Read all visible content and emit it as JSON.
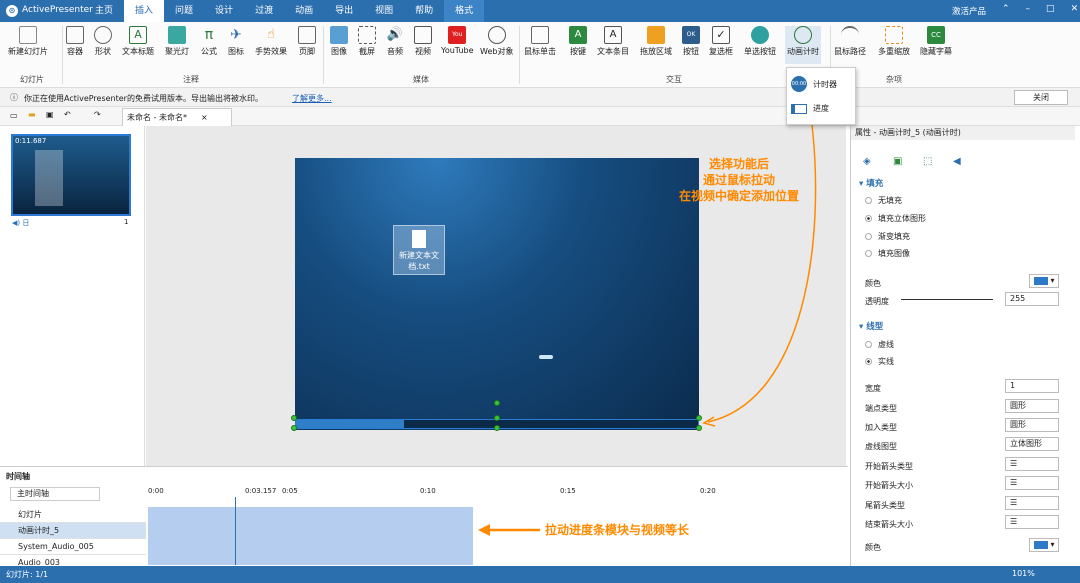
{
  "app": {
    "name": "ActivePresenter",
    "product": "激活产品",
    "controls": [
      "⌃",
      "–",
      "□",
      "✕"
    ]
  },
  "tabs": [
    "主页",
    "插入",
    "问题",
    "设计",
    "过渡",
    "动画",
    "导出",
    "视图",
    "帮助",
    "格式"
  ],
  "ribbon": {
    "items": [
      "新建幻灯片",
      "容器",
      "形状",
      "文本标题",
      "聚光灯",
      "公式",
      "图标",
      "手势效果",
      "页脚",
      "图像",
      "截屏",
      "音频",
      "视频",
      "YouTube",
      "Web对象",
      "鼠标单击",
      "按键",
      "文本条目",
      "拖放区域",
      "按钮",
      "复选框",
      "单选按钮",
      "动画计时",
      "鼠标路径",
      "多重缩放",
      "隐藏字幕"
    ],
    "groups": [
      "幻灯片",
      "注释",
      "媒体",
      "交互",
      "杂项"
    ]
  },
  "dropdown": {
    "timer": "计时器",
    "progress": "进度",
    "timer_icon": "00:00"
  },
  "info": {
    "message": "你正在使用ActivePresenter的免费试用版本。导出输出将被水印。",
    "link": "了解更多...",
    "close": "关闭"
  },
  "doc": {
    "tab": "未命名 - 未命名*"
  },
  "thumb": {
    "time": "0:11.687",
    "label": "◀) 日",
    "num": "1"
  },
  "slide": {
    "file_label": "新建文本文档.txt"
  },
  "annotations": {
    "top": "选择功能后\n通过鼠标拉动\n在视频中确定添加位置",
    "bottom": "拉动进度条模块与视频等长"
  },
  "props": {
    "title": "属性 - 动画计时_5 (动画计时)",
    "fill": "填充",
    "fill_options": [
      "无填充",
      "填充立体图形",
      "渐变填充",
      "填充图像"
    ],
    "color": "颜色",
    "opacity": "透明度",
    "opacity_value": "255",
    "line": "线型",
    "line_options": [
      "虚线",
      "实线"
    ],
    "width": "宽度",
    "width_value": "1",
    "rows": [
      {
        "label": "端点类型",
        "value": "圆形"
      },
      {
        "label": "加入类型",
        "value": "圆形"
      },
      {
        "label": "虚线图型",
        "value": "立体图形"
      },
      {
        "label": "开始箭头类型",
        "value": "☰"
      },
      {
        "label": "开始箭头大小",
        "value": "☰"
      },
      {
        "label": "尾箭头类型",
        "value": "☰"
      },
      {
        "label": "结束箭头大小",
        "value": "☰"
      }
    ],
    "color2": "颜色",
    "colors": {
      "fill": "#2d7ac8",
      "line": "#2d7ac8"
    }
  },
  "timeline": {
    "title": "时间轴",
    "track_select": "主时间轴",
    "rows": [
      "幻灯片",
      "动画计时_5",
      "System_Audio_005",
      "Audio_003"
    ],
    "ticks": [
      "0:00",
      "0:03.157",
      "0:05",
      "0:10",
      "0:15",
      "0:20"
    ]
  },
  "status": {
    "slide": "幻灯片: 1/1",
    "zoom": "101%"
  }
}
